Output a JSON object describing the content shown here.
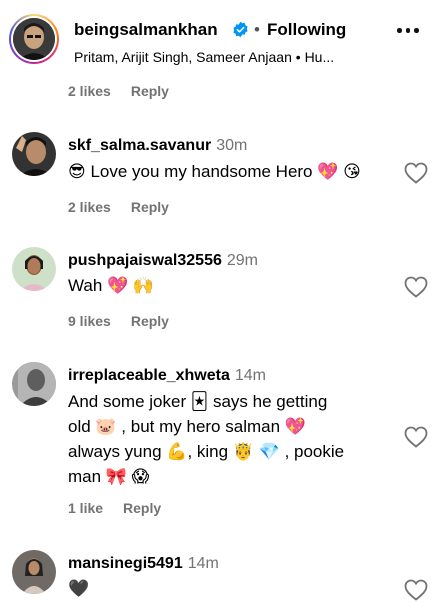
{
  "post_header": {
    "username": "beingsalmankhan",
    "separator": "•",
    "follow_status": "Following",
    "audio": "Pritam, Arijit Singh, Sameer Anjaan • Hu..."
  },
  "first_meta": {
    "likes": "2 likes",
    "reply": "Reply"
  },
  "comments": [
    {
      "username": "skf_salma.savanur",
      "time": "30m",
      "text": "😎 Love you my handsome Hero 💖 😘",
      "likes": "2 likes",
      "reply": "Reply"
    },
    {
      "username": "pushpajaiswal32556",
      "time": "29m",
      "text": "Wah 💖 🙌",
      "likes": "9 likes",
      "reply": "Reply"
    },
    {
      "username": "irreplaceable_xhweta",
      "time": "14m",
      "line1": "And some joker 🃏 says he getting",
      "line2": "old 🐷 , but my hero salman 💖",
      "line3": "always yung 💪, king 🤴 💎 , pookie",
      "line4": "man 🎀 😱",
      "likes": "1 like",
      "reply": "Reply"
    },
    {
      "username": "mansinegi5491",
      "time": "14m",
      "text": "🖤"
    }
  ],
  "colors": {
    "secondary_text": "#737373",
    "verified": "#0095f6"
  }
}
